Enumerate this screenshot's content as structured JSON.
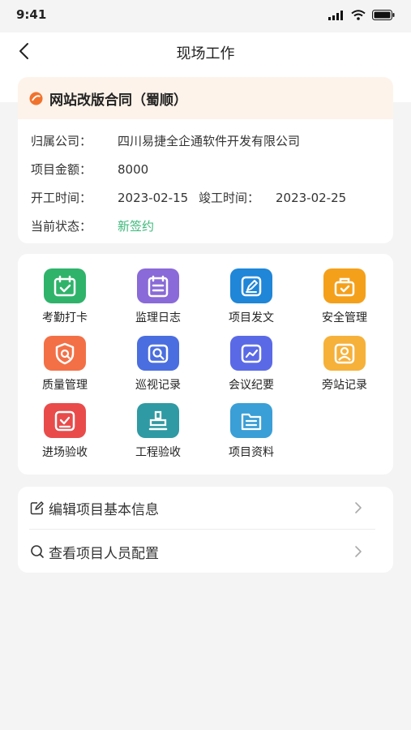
{
  "status_bar": {
    "time": "9:41"
  },
  "nav": {
    "title": "现场工作"
  },
  "project": {
    "title": "网站改版合同（蜀顺）",
    "company_label": "归属公司：",
    "company": "四川易捷全企通软件开发有限公司",
    "amount_label": "项目金额：",
    "amount": "8000",
    "start_label": "开工时间：",
    "start": "2023-02-15",
    "end_label": "竣工时间：",
    "end": "2023-02-25",
    "status_label": "当前状态：",
    "status": "新签约",
    "status_color": "#3cb87a"
  },
  "modules": [
    {
      "label": "考勤打卡",
      "icon": "calendar-check-icon",
      "color": "#2fb36b"
    },
    {
      "label": "监理日志",
      "icon": "log-list-icon",
      "color": "#8a6ad8"
    },
    {
      "label": "项目发文",
      "icon": "edit-document-icon",
      "color": "#1f86d8"
    },
    {
      "label": "安全管理",
      "icon": "safety-bag-icon",
      "color": "#f5a01a"
    },
    {
      "label": "质量管理",
      "icon": "quality-shield-icon",
      "color": "#f37046"
    },
    {
      "label": "巡视记录",
      "icon": "patrol-search-icon",
      "color": "#4a6ee0"
    },
    {
      "label": "会议纪要",
      "icon": "meeting-chart-icon",
      "color": "#5a6ae6"
    },
    {
      "label": "旁站记录",
      "icon": "person-card-icon",
      "color": "#f6b13a"
    },
    {
      "label": "进场验收",
      "icon": "entry-check-icon",
      "color": "#e94b4b"
    },
    {
      "label": "工程验收",
      "icon": "stamp-icon",
      "color": "#2f9aa3"
    },
    {
      "label": "项目资料",
      "icon": "folder-icon",
      "color": "#3a9fd6"
    }
  ],
  "menu": {
    "edit_label": "编辑项目基本信息",
    "view_label": "查看项目人员配置"
  }
}
